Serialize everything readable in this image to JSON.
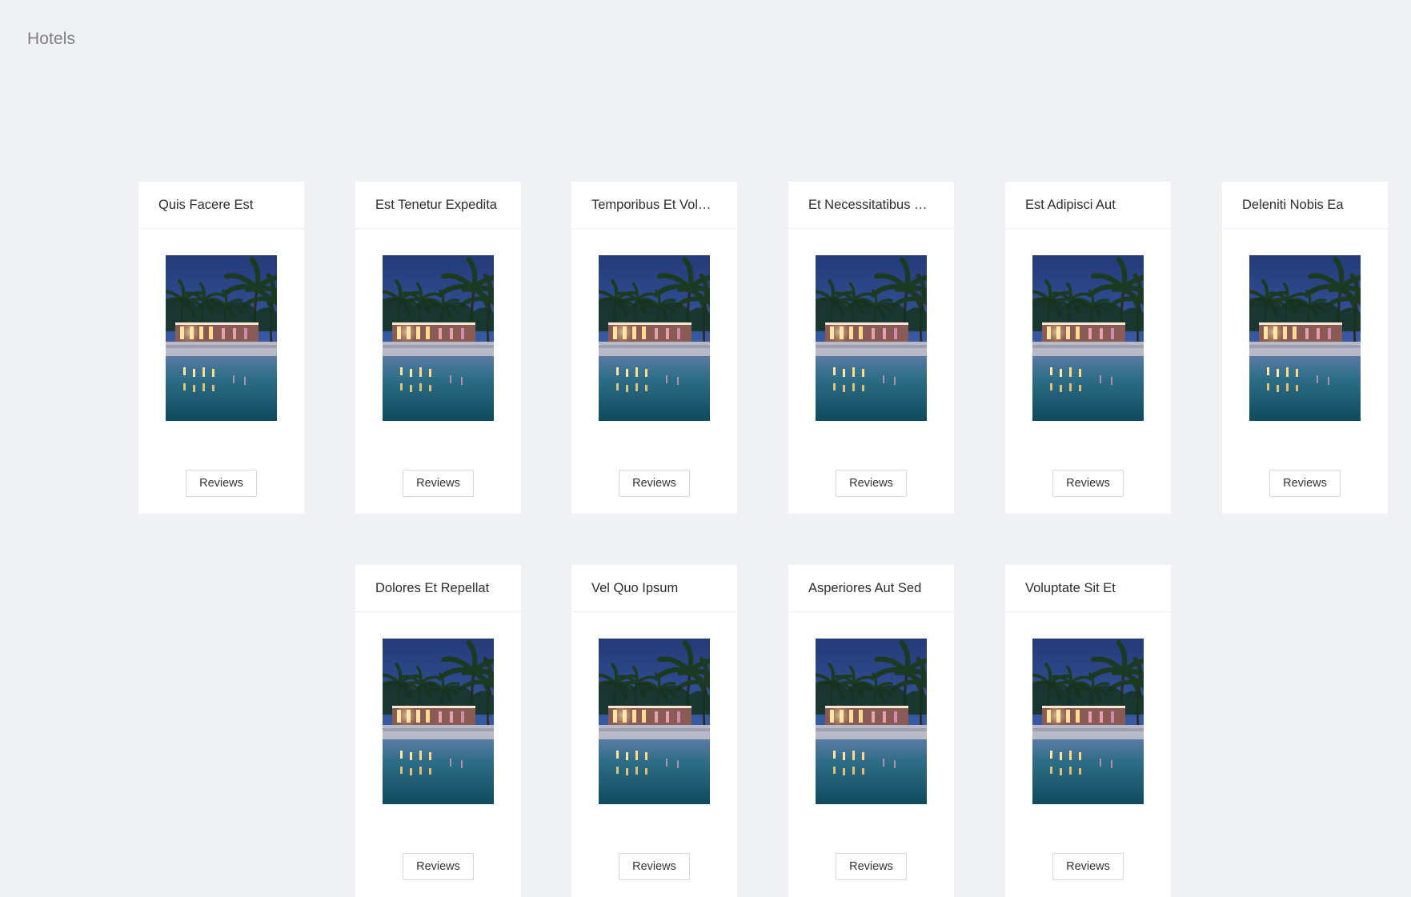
{
  "page": {
    "title": "Hotels"
  },
  "hotels": [
    {
      "name": "Quis Facere Est",
      "button_label": "Reviews",
      "image_icon": "hotel-photo-icon"
    },
    {
      "name": "Est Tenetur Expedita",
      "button_label": "Reviews",
      "image_icon": "hotel-photo-icon"
    },
    {
      "name": "Temporibus Et Vol…",
      "button_label": "Reviews",
      "image_icon": "hotel-photo-icon"
    },
    {
      "name": "Et Necessitatibus …",
      "button_label": "Reviews",
      "image_icon": "hotel-photo-icon"
    },
    {
      "name": "Est Adipisci Aut",
      "button_label": "Reviews",
      "image_icon": "hotel-photo-icon"
    },
    {
      "name": "Deleniti Nobis Ea",
      "button_label": "Reviews",
      "image_icon": "hotel-photo-icon"
    },
    {
      "name": "Dolores Et Repellat",
      "button_label": "Reviews",
      "image_icon": "hotel-photo-icon"
    },
    {
      "name": "Vel Quo Ipsum",
      "button_label": "Reviews",
      "image_icon": "hotel-photo-icon"
    },
    {
      "name": "Asperiores Aut Sed",
      "button_label": "Reviews",
      "image_icon": "hotel-photo-icon"
    },
    {
      "name": "Voluptate Sit Et",
      "button_label": "Reviews",
      "image_icon": "hotel-photo-icon"
    }
  ],
  "colors": {
    "background": "#f0f1f4",
    "card": "#ffffff",
    "title_text": "#7d7f82",
    "card_text": "#2b2d30"
  }
}
